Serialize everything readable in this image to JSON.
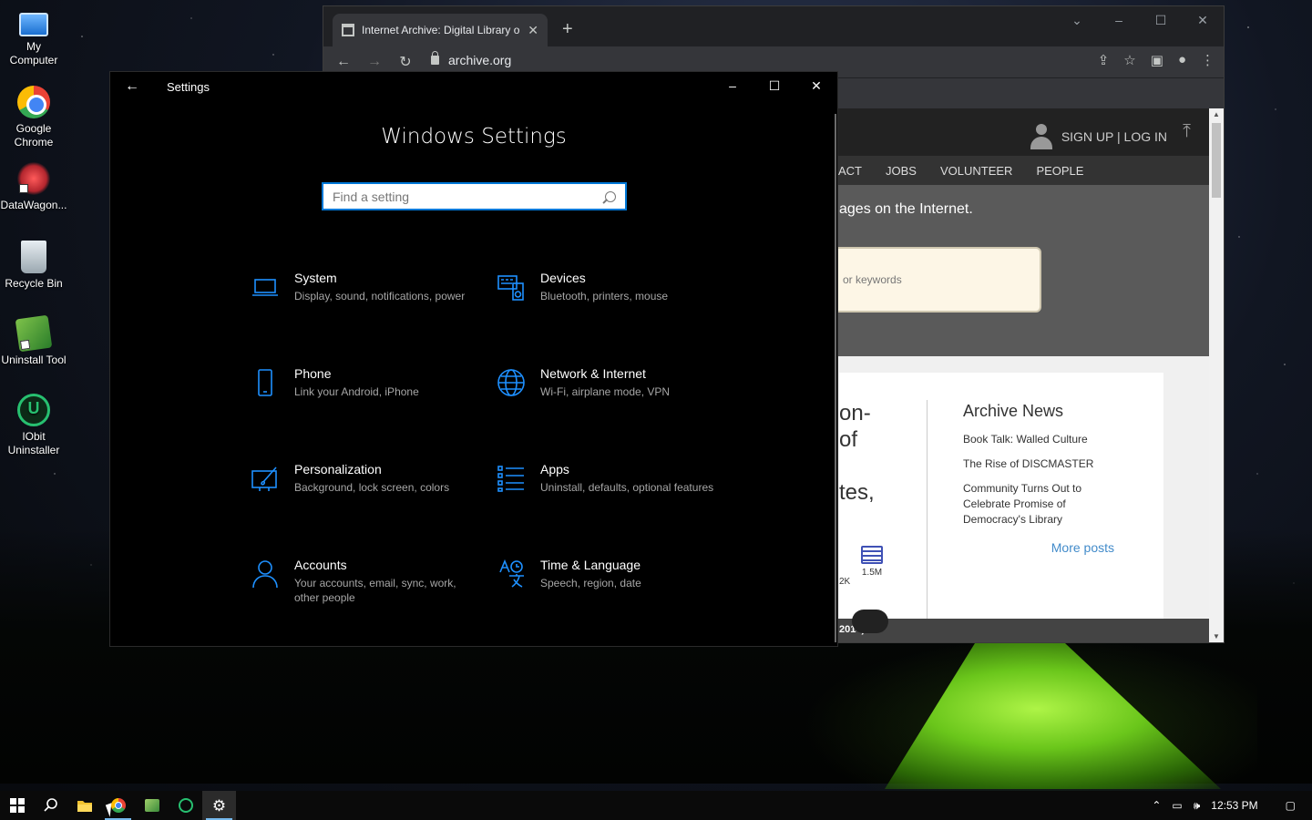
{
  "desktop": {
    "icons": [
      {
        "label": "My\nComputer",
        "line1": "My",
        "line2": "Computer"
      },
      {
        "line1": "Google",
        "line2": "Chrome"
      },
      {
        "line1": "DataWagon...",
        "line2": ""
      },
      {
        "line1": "Recycle Bin",
        "line2": ""
      },
      {
        "line1": "Uninstall Tool",
        "line2": ""
      },
      {
        "line1": "IObit",
        "line2": "Uninstaller"
      }
    ]
  },
  "chrome": {
    "tab_title": "Internet Archive: Digital Library o",
    "url": "archive.org",
    "page": {
      "auth": "SIGN UP | LOG IN",
      "nav": [
        "ACT",
        "JOBS",
        "VOLUNTEER",
        "PEOPLE"
      ],
      "tagline": "ages on the Internet.",
      "search_placeholder": "or keywords",
      "big_text": [
        "on-",
        "of",
        "tes,"
      ],
      "stats": [
        "2K",
        "1.5M"
      ],
      "footer_text": "2014)",
      "news": {
        "title": "Archive News",
        "items": [
          "Book Talk: Walled Culture",
          "The Rise of DISCMASTER",
          "Community Turns Out to Celebrate Promise of Democracy's Library"
        ],
        "more": "More posts"
      }
    }
  },
  "settings": {
    "window_title": "Settings",
    "heading": "Windows Settings",
    "search_placeholder": "Find a setting",
    "accent": "#0078d7",
    "tiles": [
      {
        "name": "System",
        "desc": "Display, sound, notifications, power",
        "icon": "laptop-icon"
      },
      {
        "name": "Devices",
        "desc": "Bluetooth, printers, mouse",
        "icon": "devices-icon"
      },
      {
        "name": "Phone",
        "desc": "Link your Android, iPhone",
        "icon": "phone-icon"
      },
      {
        "name": "Network & Internet",
        "desc": "Wi-Fi, airplane mode, VPN",
        "icon": "globe-icon"
      },
      {
        "name": "Personalization",
        "desc": "Background, lock screen, colors",
        "icon": "paint-icon"
      },
      {
        "name": "Apps",
        "desc": "Uninstall, defaults, optional features",
        "icon": "apps-list-icon"
      },
      {
        "name": "Accounts",
        "desc": "Your accounts, email, sync, work, other people",
        "icon": "person-icon"
      },
      {
        "name": "Time & Language",
        "desc": "Speech, region, date",
        "icon": "time-language-icon"
      }
    ]
  },
  "taskbar": {
    "time": "12:53 PM"
  }
}
